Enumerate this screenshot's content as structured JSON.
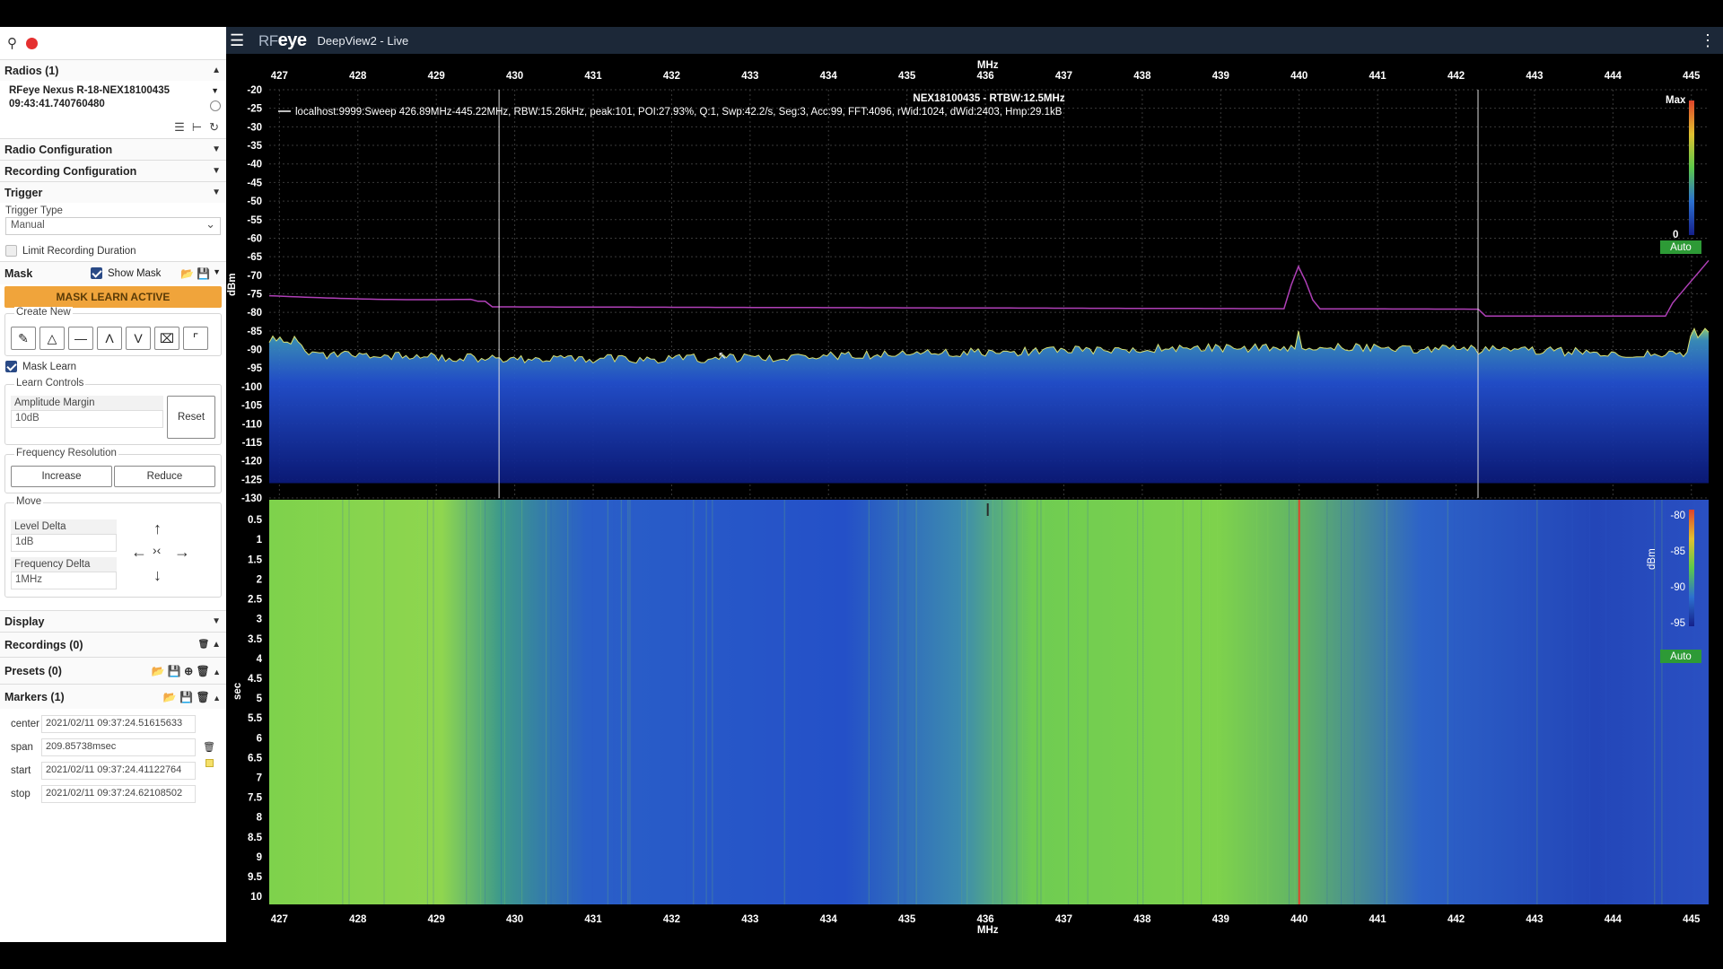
{
  "sidebar": {
    "radios_header": "Radios (1)",
    "radio_name": "RFeye Nexus R-18-NEX18100435",
    "radio_time": "09:43:41.740760480",
    "radio_config": "Radio Configuration",
    "recording_config": "Recording Configuration",
    "trigger": "Trigger",
    "trigger_type_label": "Trigger Type",
    "trigger_type_value": "Manual",
    "limit_duration": "Limit Recording Duration",
    "mask": "Mask",
    "show_mask": "Show Mask",
    "mask_learn_banner": "MASK LEARN ACTIVE",
    "create_new": "Create New",
    "mask_learn": "Mask Learn",
    "learn_controls": "Learn Controls",
    "amplitude_margin_label": "Amplitude Margin",
    "amplitude_margin_value": "10dB",
    "reset": "Reset",
    "frequency_resolution": "Frequency Resolution",
    "increase": "Increase",
    "reduce": "Reduce",
    "move": "Move",
    "level_delta_label": "Level Delta",
    "level_delta_value": "1dB",
    "frequency_delta_label": "Frequency Delta",
    "frequency_delta_value": "1MHz",
    "display": "Display",
    "recordings": "Recordings (0)",
    "presets": "Presets (0)",
    "markers": "Markers (1)",
    "marker_fields": [
      {
        "key": "center",
        "value": "2021/02/11 09:37:24.51615633"
      },
      {
        "key": "span",
        "value": "209.85738msec"
      },
      {
        "key": "start",
        "value": "2021/02/11 09:37:24.41122764"
      },
      {
        "key": "stop",
        "value": "2021/02/11 09:37:24.62108502"
      }
    ]
  },
  "topbar": {
    "brand_rf": "RF",
    "brand_eye": "eye",
    "title": "DeepView2 - Live"
  },
  "plot": {
    "freq_unit": "MHz",
    "freq_ticks": [
      427,
      428,
      429,
      430,
      431,
      432,
      433,
      434,
      435,
      436,
      437,
      438,
      439,
      440,
      441,
      442,
      443,
      444,
      445
    ],
    "spectrum_title": "NEX18100435 - RTBW:12.5MHz",
    "sweep_info": "localhost:9999:Sweep 426.89MHz-445.22MHz, RBW:15.26kHz, peak:101, POI:27.93%, Q:1, Swp:42.2/s, Seg:3, Acc:99, FFT:4096, rWid:1024, dWid:2403,  Hmp:29.1kB",
    "dbm_label": "dBm",
    "dbm_ticks": [
      -20,
      -25,
      -30,
      -35,
      -40,
      -45,
      -50,
      -55,
      -60,
      -65,
      -70,
      -75,
      -80,
      -85,
      -90,
      -95,
      -100,
      -105,
      -110,
      -115,
      -120,
      -125,
      -130
    ],
    "spectrum_scale_max": "Max",
    "spectrum_scale_min": "0",
    "auto_label": "Auto",
    "sec_label": "sec",
    "time_ticks": [
      "0.5",
      "1",
      "1.5",
      "2",
      "2.5",
      "3",
      "3.5",
      "4",
      "4.5",
      "5",
      "5.5",
      "6",
      "6.5",
      "7",
      "7.5",
      "8",
      "8.5",
      "9",
      "9.5",
      "10"
    ],
    "wf_scale_ticks": [
      "-80",
      "-85",
      "-90",
      "-95"
    ],
    "wf_scale_unit": "dBm",
    "colors": {
      "mask_line": "#b040b8",
      "noise_trace": "#d8e070",
      "marker_line": "#e0432a",
      "auto_badge": "#2d9a36",
      "header": "#1c2838",
      "mask_banner": "#f0a43b"
    }
  }
}
